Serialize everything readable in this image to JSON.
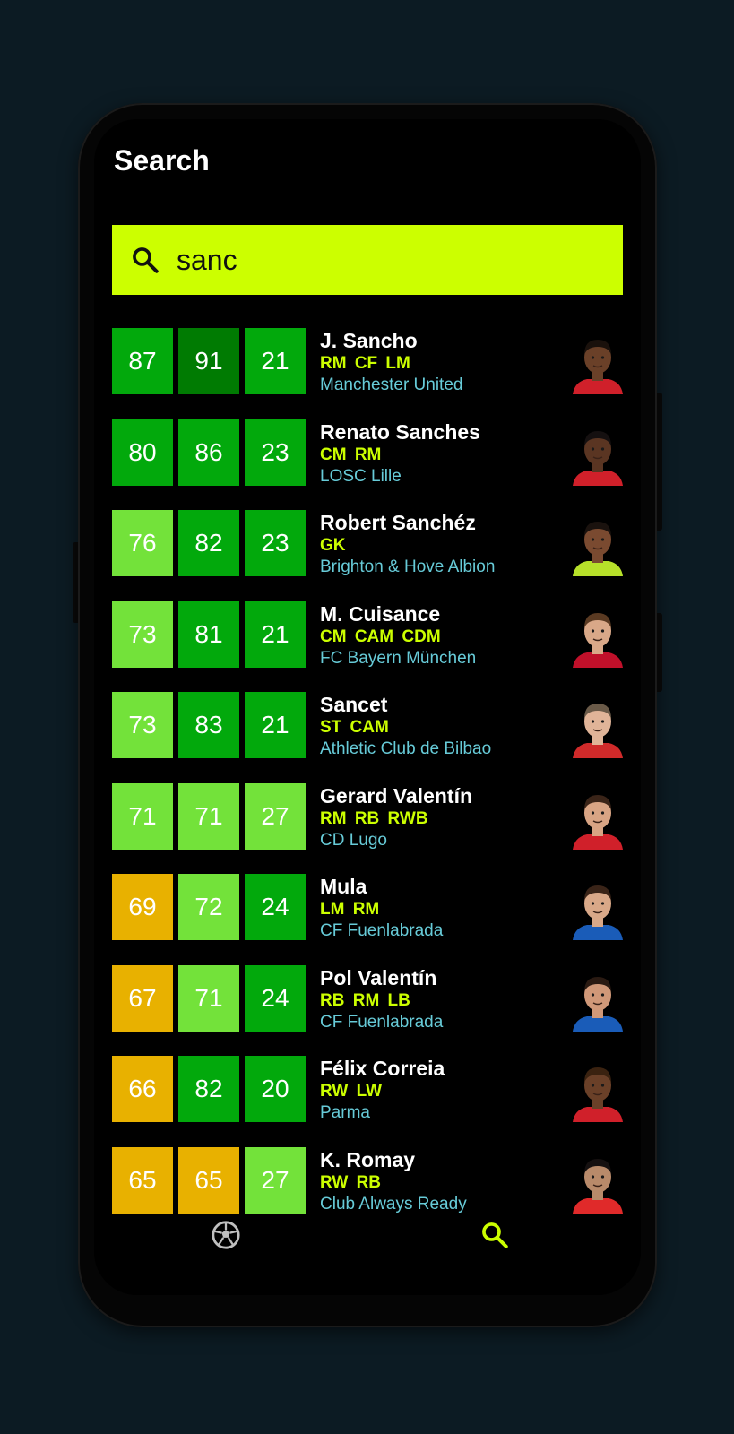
{
  "screen": {
    "title": "Search"
  },
  "search": {
    "query": "sanc",
    "accent": "#ccff00"
  },
  "colors": {
    "gold": "#e8b100",
    "light_green": "#73e23a",
    "green": "#02a90c",
    "dark_green": "#007b02",
    "position_text": "#ccff00",
    "club_text": "#67cbd8"
  },
  "players": [
    {
      "name": "J. Sancho",
      "positions": "RM CF LM",
      "club": "Manchester United",
      "stats": [
        {
          "value": "87",
          "tier": "mid"
        },
        {
          "value": "91",
          "tier": "dark"
        },
        {
          "value": "21",
          "tier": "mid"
        }
      ],
      "avatar": {
        "skin": "#6a4028",
        "hair": "#1a110c",
        "kit": "#d0202a"
      }
    },
    {
      "name": "Renato Sanches",
      "positions": "CM RM",
      "club": "LOSC Lille",
      "stats": [
        {
          "value": "80",
          "tier": "mid"
        },
        {
          "value": "86",
          "tier": "mid"
        },
        {
          "value": "23",
          "tier": "mid"
        }
      ],
      "avatar": {
        "skin": "#5a3522",
        "hair": "#151010",
        "kit": "#d0202a"
      }
    },
    {
      "name": "Robert Sanchéz",
      "positions": "GK",
      "club": "Brighton & Hove Albion",
      "stats": [
        {
          "value": "76",
          "tier": "light"
        },
        {
          "value": "82",
          "tier": "mid"
        },
        {
          "value": "23",
          "tier": "mid"
        }
      ],
      "avatar": {
        "skin": "#7a4a30",
        "hair": "#1a120e",
        "kit": "#b6e02a"
      }
    },
    {
      "name": "M. Cuisance",
      "positions": "CM CAM CDM",
      "club": "FC Bayern München",
      "stats": [
        {
          "value": "73",
          "tier": "light"
        },
        {
          "value": "81",
          "tier": "mid"
        },
        {
          "value": "21",
          "tier": "mid"
        }
      ],
      "avatar": {
        "skin": "#d9a888",
        "hair": "#5a3a22",
        "kit": "#c0102a"
      }
    },
    {
      "name": "Sancet",
      "positions": "ST CAM",
      "club": "Athletic Club de Bilbao",
      "stats": [
        {
          "value": "73",
          "tier": "light"
        },
        {
          "value": "83",
          "tier": "mid"
        },
        {
          "value": "21",
          "tier": "mid"
        }
      ],
      "avatar": {
        "skin": "#e0b498",
        "hair": "#6a5a48",
        "kit": "#d02a2a"
      }
    },
    {
      "name": "Gerard Valentín",
      "positions": "RM RB RWB",
      "club": "CD Lugo",
      "stats": [
        {
          "value": "71",
          "tier": "light"
        },
        {
          "value": "71",
          "tier": "light"
        },
        {
          "value": "27",
          "tier": "light"
        }
      ],
      "avatar": {
        "skin": "#d8a484",
        "hair": "#3a2418",
        "kit": "#d0202a"
      }
    },
    {
      "name": "Mula",
      "positions": "LM RM",
      "club": "CF Fuenlabrada",
      "stats": [
        {
          "value": "69",
          "tier": "gold"
        },
        {
          "value": "72",
          "tier": "light"
        },
        {
          "value": "24",
          "tier": "mid"
        }
      ],
      "avatar": {
        "skin": "#d9a888",
        "hair": "#3a2418",
        "kit": "#1a5cb8"
      }
    },
    {
      "name": "Pol Valentín",
      "positions": "RB RM LB",
      "club": "CF Fuenlabrada",
      "stats": [
        {
          "value": "67",
          "tier": "gold"
        },
        {
          "value": "71",
          "tier": "light"
        },
        {
          "value": "24",
          "tier": "mid"
        }
      ],
      "avatar": {
        "skin": "#d09878",
        "hair": "#2a1a12",
        "kit": "#1a5cb8"
      }
    },
    {
      "name": "Félix Correia",
      "positions": "RW LW",
      "club": "Parma",
      "stats": [
        {
          "value": "66",
          "tier": "gold"
        },
        {
          "value": "82",
          "tier": "mid"
        },
        {
          "value": "20",
          "tier": "mid"
        }
      ],
      "avatar": {
        "skin": "#6a4028",
        "hair": "#3a2210",
        "kit": "#d0202a"
      }
    },
    {
      "name": "K. Romay",
      "positions": "RW RB",
      "club": "Club Always Ready",
      "stats": [
        {
          "value": "65",
          "tier": "gold"
        },
        {
          "value": "65",
          "tier": "gold"
        },
        {
          "value": "27",
          "tier": "light"
        }
      ],
      "avatar": {
        "skin": "#b88a6a",
        "hair": "#151010",
        "kit": "#e02a2a"
      }
    }
  ],
  "nav": [
    {
      "icon": "soccer-ball-icon",
      "active": false
    },
    {
      "icon": "search-icon",
      "active": true,
      "accent": "#ccff00"
    }
  ]
}
